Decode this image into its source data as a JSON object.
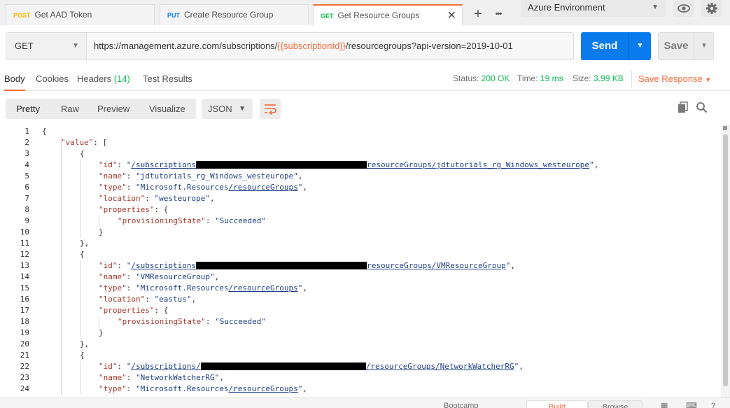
{
  "tabs": [
    {
      "method": "POST",
      "name": "Get AAD Token"
    },
    {
      "method": "PUT",
      "name": "Create Resource Group"
    },
    {
      "method": "GET",
      "name": "Get Resource Groups"
    }
  ],
  "tab_strip": {
    "add": "+",
    "more": "•••",
    "close": "✕"
  },
  "environment": {
    "selected": "Azure Environment"
  },
  "request": {
    "method": "GET",
    "url_prefix": "https://management.azure.com/subscriptions/",
    "url_variable": "{{subscriptionId}}",
    "url_suffix": "/resourcegroups?api-version=2019-10-01",
    "send_label": "Send",
    "save_label": "Save"
  },
  "response_tabs": {
    "body": "Body",
    "cookies": "Cookies",
    "headers": "Headers",
    "headers_count": "(14)",
    "test_results": "Test Results"
  },
  "response_meta": {
    "status_label": "Status:",
    "status_value": "200 OK",
    "time_label": "Time:",
    "time_value": "19 ms",
    "size_label": "Size:",
    "size_value": "3.99 KB",
    "save_response": "Save Response"
  },
  "viewer": {
    "modes": [
      "Pretty",
      "Raw",
      "Preview",
      "Visualize"
    ],
    "format": "JSON"
  },
  "code_lines": [
    {
      "n": "1",
      "indent": 0,
      "parts": [
        [
          "p",
          "{"
        ]
      ]
    },
    {
      "n": "2",
      "indent": 1,
      "parts": [
        [
          "k",
          "\"value\""
        ],
        [
          "p",
          ": ["
        ]
      ]
    },
    {
      "n": "3",
      "indent": 2,
      "parts": [
        [
          "p",
          "{"
        ]
      ]
    },
    {
      "n": "4",
      "indent": 3,
      "parts": [
        [
          "k",
          "\"id\""
        ],
        [
          "p",
          ": "
        ],
        [
          "s",
          "\""
        ],
        [
          "l",
          "/subscriptions"
        ],
        [
          "r",
          "redacted"
        ],
        [
          "l",
          "resourceGroups/jdtutorials_rg_Windows_westeurope"
        ],
        [
          "s",
          "\""
        ],
        [
          "p",
          ","
        ]
      ]
    },
    {
      "n": "5",
      "indent": 3,
      "parts": [
        [
          "k",
          "\"name\""
        ],
        [
          "p",
          ": "
        ],
        [
          "s",
          "\"jdtutorials_rg_Windows_westeurope\""
        ],
        [
          "p",
          ","
        ]
      ]
    },
    {
      "n": "6",
      "indent": 3,
      "parts": [
        [
          "k",
          "\"type\""
        ],
        [
          "p",
          ": "
        ],
        [
          "s",
          "\"Microsoft.Resources"
        ],
        [
          "l",
          "/resourceGroups"
        ],
        [
          "s",
          "\""
        ],
        [
          "p",
          ","
        ]
      ]
    },
    {
      "n": "7",
      "indent": 3,
      "parts": [
        [
          "k",
          "\"location\""
        ],
        [
          "p",
          ": "
        ],
        [
          "s",
          "\"westeurope\""
        ],
        [
          "p",
          ","
        ]
      ]
    },
    {
      "n": "8",
      "indent": 3,
      "parts": [
        [
          "k",
          "\"properties\""
        ],
        [
          "p",
          ": {"
        ]
      ]
    },
    {
      "n": "9",
      "indent": 4,
      "parts": [
        [
          "k",
          "\"provisioningState\""
        ],
        [
          "p",
          ": "
        ],
        [
          "s",
          "\"Succeeded\""
        ]
      ]
    },
    {
      "n": "10",
      "indent": 3,
      "parts": [
        [
          "p",
          "}"
        ]
      ]
    },
    {
      "n": "11",
      "indent": 2,
      "parts": [
        [
          "p",
          "},"
        ]
      ]
    },
    {
      "n": "12",
      "indent": 2,
      "parts": [
        [
          "p",
          "{"
        ]
      ]
    },
    {
      "n": "13",
      "indent": 3,
      "parts": [
        [
          "k",
          "\"id\""
        ],
        [
          "p",
          ": "
        ],
        [
          "s",
          "\""
        ],
        [
          "l",
          "/subscriptions"
        ],
        [
          "r",
          "redacted"
        ],
        [
          "l",
          "resourceGroups/VMResourceGroup"
        ],
        [
          "s",
          "\""
        ],
        [
          "p",
          ","
        ]
      ]
    },
    {
      "n": "14",
      "indent": 3,
      "parts": [
        [
          "k",
          "\"name\""
        ],
        [
          "p",
          ": "
        ],
        [
          "s",
          "\"VMResourceGroup\""
        ],
        [
          "p",
          ","
        ]
      ]
    },
    {
      "n": "15",
      "indent": 3,
      "parts": [
        [
          "k",
          "\"type\""
        ],
        [
          "p",
          ": "
        ],
        [
          "s",
          "\"Microsoft.Resources"
        ],
        [
          "l",
          "/resourceGroups"
        ],
        [
          "s",
          "\""
        ],
        [
          "p",
          ","
        ]
      ]
    },
    {
      "n": "16",
      "indent": 3,
      "parts": [
        [
          "k",
          "\"location\""
        ],
        [
          "p",
          ": "
        ],
        [
          "s",
          "\"eastus\""
        ],
        [
          "p",
          ","
        ]
      ]
    },
    {
      "n": "17",
      "indent": 3,
      "parts": [
        [
          "k",
          "\"properties\""
        ],
        [
          "p",
          ": {"
        ]
      ]
    },
    {
      "n": "18",
      "indent": 4,
      "parts": [
        [
          "k",
          "\"provisioningState\""
        ],
        [
          "p",
          ": "
        ],
        [
          "s",
          "\"Succeeded\""
        ]
      ]
    },
    {
      "n": "19",
      "indent": 3,
      "parts": [
        [
          "p",
          "}"
        ]
      ]
    },
    {
      "n": "20",
      "indent": 2,
      "parts": [
        [
          "p",
          "},"
        ]
      ]
    },
    {
      "n": "21",
      "indent": 2,
      "parts": [
        [
          "p",
          "{"
        ]
      ]
    },
    {
      "n": "22",
      "indent": 3,
      "parts": [
        [
          "k",
          "\"id\""
        ],
        [
          "p",
          ": "
        ],
        [
          "s",
          "\""
        ],
        [
          "l",
          "/subscriptions/"
        ],
        [
          "r",
          "redacted"
        ],
        [
          "l",
          "/resourceGroups/NetworkWatcherRG"
        ],
        [
          "s",
          "\""
        ],
        [
          "p",
          ","
        ]
      ]
    },
    {
      "n": "23",
      "indent": 3,
      "parts": [
        [
          "k",
          "\"name\""
        ],
        [
          "p",
          ": "
        ],
        [
          "s",
          "\"NetworkWatcherRG\""
        ],
        [
          "p",
          ","
        ]
      ]
    },
    {
      "n": "24",
      "indent": 3,
      "parts": [
        [
          "k",
          "\"type\""
        ],
        [
          "p",
          ": "
        ],
        [
          "s",
          "\"Microsoft.Resources"
        ],
        [
          "l",
          "/resourceGroups"
        ],
        [
          "s",
          "\""
        ],
        [
          "p",
          ","
        ]
      ]
    }
  ],
  "bottom_bar": {
    "bootcamp": "Bootcamp",
    "build": "Build",
    "browse": "Browse"
  },
  "colors": {
    "accent": "#f26b3a",
    "send_blue": "#097bed",
    "success_green": "#0cbb52",
    "post_orange": "#ffb400",
    "json_key": "#a33a2e",
    "json_string": "#1f3f86"
  }
}
